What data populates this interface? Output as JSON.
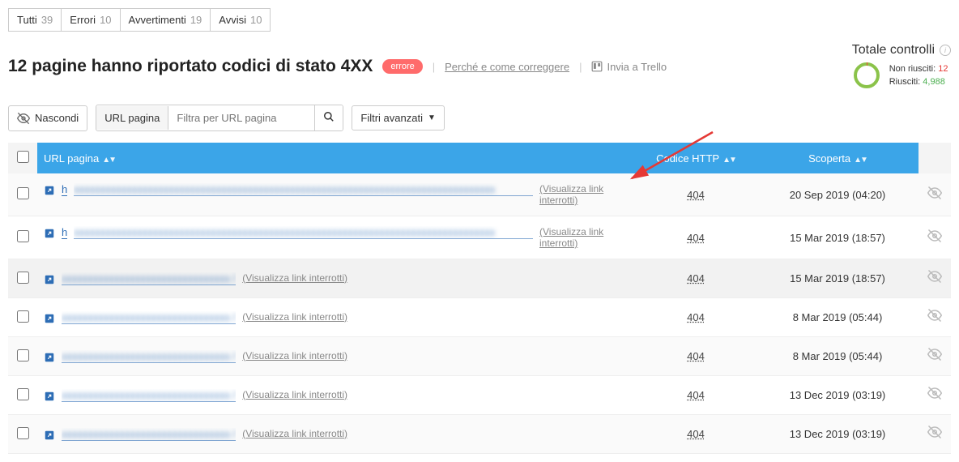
{
  "tabs": [
    {
      "label": "Tutti",
      "count": "39"
    },
    {
      "label": "Errori",
      "count": "10"
    },
    {
      "label": "Avvertimenti",
      "count": "19"
    },
    {
      "label": "Avvisi",
      "count": "10"
    }
  ],
  "title": "12 pagine hanno riportato codici di stato 4XX",
  "badge": "errore",
  "fix_link": "Perché e come correggere",
  "trello_link": "Invia a Trello",
  "totals": {
    "title": "Totale controlli",
    "fail_label": "Non riusciti:",
    "fail_count": "12",
    "pass_label": "Riusciti:",
    "pass_count": "4,988"
  },
  "toolbar": {
    "hide": "Nascondi",
    "url_label": "URL pagina",
    "search_placeholder": "Filtra per URL pagina",
    "adv_filters": "Filtri avanzati"
  },
  "columns": {
    "url": "URL pagina",
    "code": "Codice HTTP",
    "discovered": "Scoperta"
  },
  "vis_label_short": "(Visualizza link interrotti)",
  "vis_label_wrap": "(Visualizza link interrotti)",
  "rows": [
    {
      "url_start": "h",
      "url_blur": "xxxxxxxxxxxxxxxxxxxxxxxxxxxxxxxxxxxxxxxxxxxxxxxxxxxxxxxxxxxxxxxxxxxxxxxxxxxxxxxx",
      "wrap": true,
      "code": "404",
      "date": "20 Sep 2019 (04:20)"
    },
    {
      "url_start": "h",
      "url_blur": "xxxxxxxxxxxxxxxxxxxxxxxxxxxxxxxxxxxxxxxxxxxxxxxxxxxxxxxxxxxxxxxxxxxxxxxxxxxxxxxx",
      "wrap": true,
      "code": "404",
      "date": "15 Mar 2019 (18:57)"
    },
    {
      "url_start": "",
      "url_blur": "xxxxxxxxxxxxxxxxxxxxxxxxxxxxxxxx /",
      "wrap": false,
      "code": "404",
      "date": "15 Mar 2019 (18:57)"
    },
    {
      "url_start": "",
      "url_blur": "xxxxxxxxxxxxxxxxxxxxxxxxxxxxxxxx /",
      "wrap": false,
      "code": "404",
      "date": "8 Mar 2019 (05:44)"
    },
    {
      "url_start": "",
      "url_blur": "xxxxxxxxxxxxxxxxxxxxxxxxxxxxxxxx /",
      "wrap": false,
      "code": "404",
      "date": "8 Mar 2019 (05:44)"
    },
    {
      "url_start": "",
      "url_blur": "xxxxxxxxxxxxxxxxxxxxxxxxxxxxxxxx /",
      "wrap": false,
      "code": "404",
      "date": "13 Dec 2019 (03:19)"
    },
    {
      "url_start": "",
      "url_blur": "xxxxxxxxxxxxxxxxxxxxxxxxxxxxxxxx /",
      "wrap": false,
      "code": "404",
      "date": "13 Dec 2019 (03:19)"
    }
  ]
}
